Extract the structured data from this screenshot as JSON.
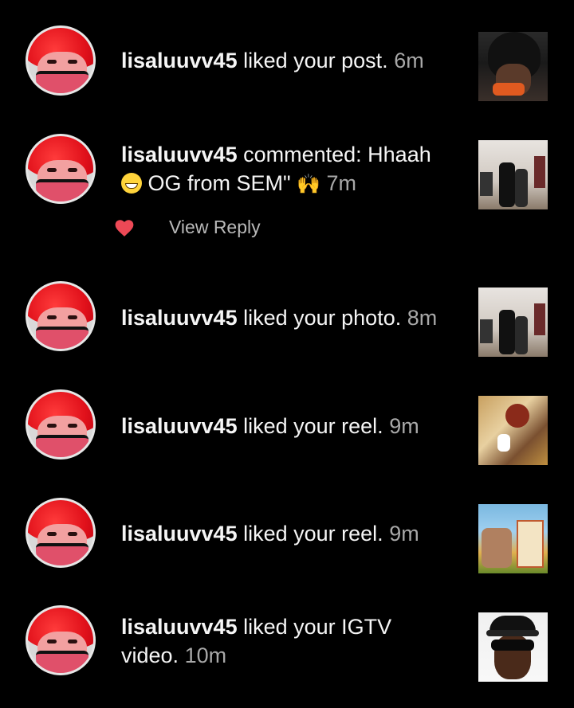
{
  "notifications": [
    {
      "username": "lisaluuvv45",
      "action_before": " liked your post.",
      "time": "6m"
    },
    {
      "username": "lisaluuvv45",
      "action_before": " commented: Hhaah",
      "line2_text": " OG from SEM\" ",
      "time": "7m",
      "reply_label": "View Reply"
    },
    {
      "username": "lisaluuvv45",
      "action_before": " liked your photo.",
      "time": "8m"
    },
    {
      "username": "lisaluuvv45",
      "action_before": " liked your reel.",
      "time": "9m"
    },
    {
      "username": "lisaluuvv45",
      "action_before": " liked your reel.",
      "time": "9m"
    },
    {
      "username": "lisaluuvv45",
      "action_before": " liked your IGTV",
      "line2_text": "video.",
      "time": "10m"
    }
  ],
  "icons": {
    "heart": "heart-icon",
    "grin_emoji": "grinning-face-emoji",
    "raised_hands_emoji": "raising-hands-emoji"
  },
  "colors": {
    "background": "#000000",
    "heart": "#ed4956",
    "time": "#a8a8a8"
  }
}
